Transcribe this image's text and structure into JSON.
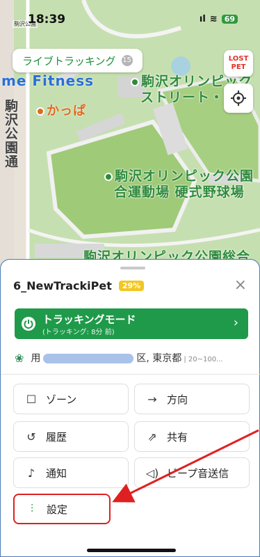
{
  "status_bar": {
    "carrier": "駒沢公園",
    "time": "18:39",
    "signal": "ıl",
    "wifi": "≋",
    "battery": "69"
  },
  "map": {
    "live_tracking_label": "ライブトラッキング",
    "live_tracking_count": "15",
    "lost_pet_line1": "LOST",
    "lost_pet_line2": "PET",
    "labels": {
      "fitness": "me Fitness",
      "olympic_street_1": "駒沢オリンピック",
      "olympic_street_2": "ストリート・",
      "kappa": "かっぱ",
      "komazawa_park": "駒沢公園通",
      "stadium_1": "駒沢オリンピック公園",
      "stadium_2": "合運動場 硬式野球場",
      "bottom_cut": "駒沢オリンピック公園総合"
    }
  },
  "sheet": {
    "pet_name": "6_NewTrackiPet",
    "battery": "29%",
    "close": "×",
    "tracking_title": "トラッキングモード",
    "tracking_sub": "(トラッキング: 8分 前)",
    "address_prefix": "用",
    "address_suffix": "区, 東京都",
    "address_range": "| 20~100...",
    "buttons": {
      "zone": "ゾーン",
      "direction": "方向",
      "history": "履歴",
      "share": "共有",
      "notification": "通知",
      "beep": "ビープ音送信",
      "settings": "設定"
    },
    "accent": "#1f9a4a",
    "highlight": "#e02020"
  }
}
